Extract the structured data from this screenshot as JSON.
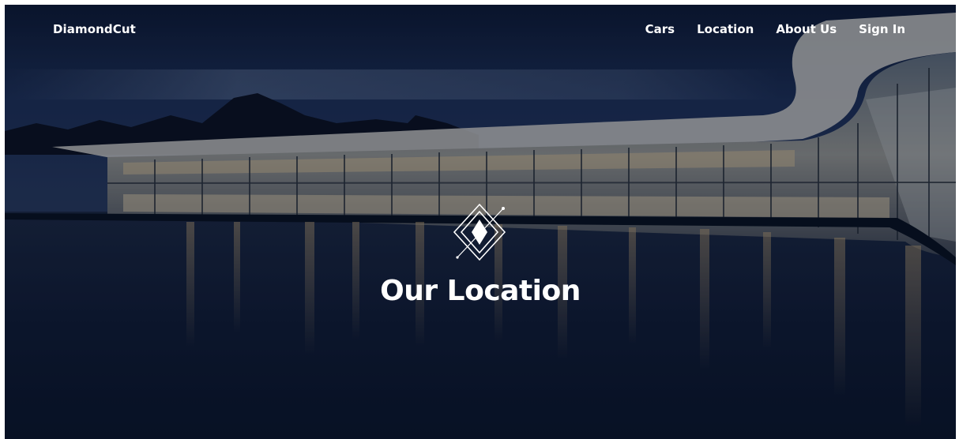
{
  "brand": {
    "name": "DiamondCut"
  },
  "nav": {
    "items": [
      {
        "label": "Cars"
      },
      {
        "label": "Location"
      },
      {
        "label": "About Us"
      },
      {
        "label": "Sign In"
      }
    ]
  },
  "hero": {
    "title": "Our Location",
    "emblem_icon": "diamond-emblem-icon"
  },
  "colors": {
    "night_sky": "#0f1d3a",
    "water": "#0a1529",
    "building_light": "#d9c7a6",
    "text": "#ffffff"
  }
}
